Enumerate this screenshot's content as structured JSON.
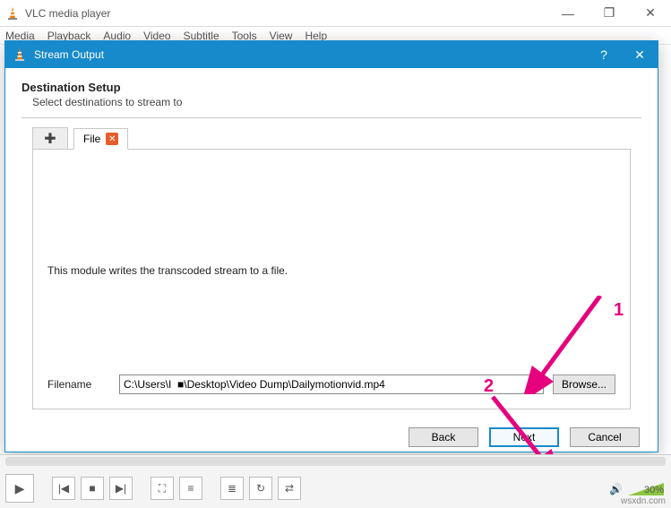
{
  "app": {
    "title": "VLC media player"
  },
  "menubar": [
    "Media",
    "Playback",
    "Audio",
    "Video",
    "Subtitle",
    "Tools",
    "View",
    "Help"
  ],
  "dialog": {
    "title": "Stream Output",
    "header": "Destination Setup",
    "subheader": "Select destinations to stream to",
    "tab_label": "File",
    "description": "This module writes the transcoded stream to a file.",
    "filename_label": "Filename",
    "filename_value": "C:\\Users\\I  ■\\Desktop\\Video Dump\\Dailymotionvid.mp4",
    "browse_label": "Browse...",
    "back_label": "Back",
    "next_label": "Next",
    "cancel_label": "Cancel"
  },
  "annotations": {
    "label1": "1",
    "label2": "2"
  },
  "player": {
    "volume_percent": "30%"
  },
  "watermark": "wsxdn.com"
}
